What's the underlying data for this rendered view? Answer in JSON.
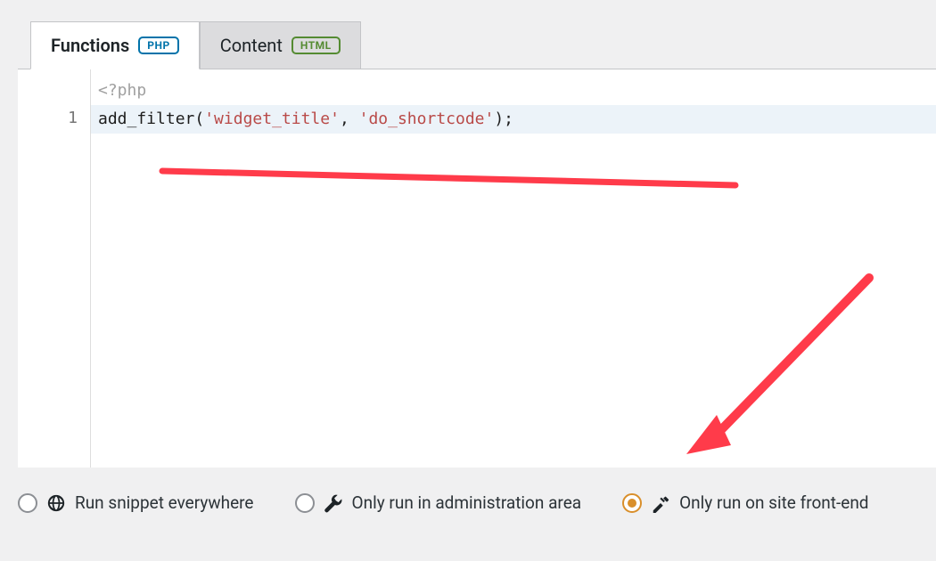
{
  "tabs": [
    {
      "label": "Functions",
      "badge": "PHP",
      "active": true
    },
    {
      "label": "Content",
      "badge": "HTML",
      "active": false
    }
  ],
  "editor": {
    "opening_tag": "<?php",
    "line_number": "1",
    "code": {
      "fn": "add_filter",
      "open": "(",
      "arg1": "'widget_title'",
      "comma": ", ",
      "arg2": "'do_shortcode'",
      "close": ");"
    }
  },
  "run_options": [
    {
      "label": "Run snippet everywhere",
      "selected": false,
      "icon": "globe"
    },
    {
      "label": "Only run in administration area",
      "selected": false,
      "icon": "wrench"
    },
    {
      "label": "Only run on site front-end",
      "selected": true,
      "icon": "hammer"
    }
  ],
  "annotation_color": "#ff3b4a"
}
